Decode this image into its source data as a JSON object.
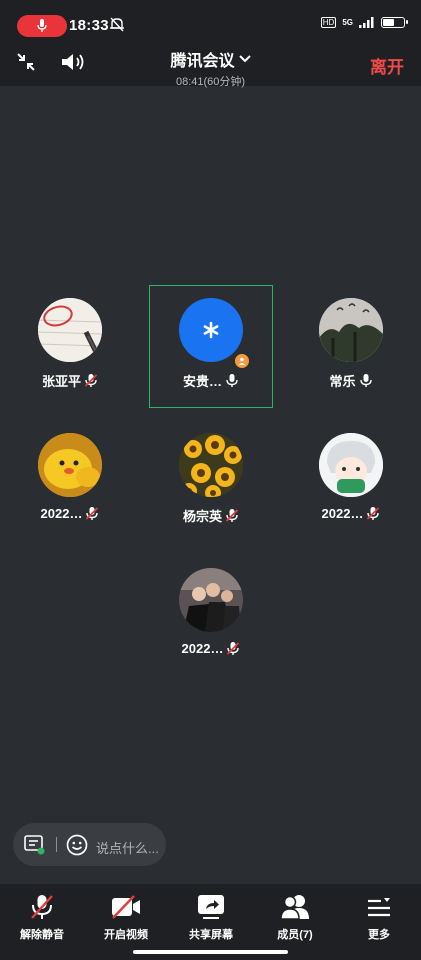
{
  "status_bar": {
    "time": "18:33",
    "hd": "HD",
    "network": "5G",
    "battery_level": 0.6
  },
  "header": {
    "title": "腾讯会议",
    "subtitle": "08:41(60分钟)",
    "leave_label": "离开"
  },
  "participants": [
    {
      "name": "张亚平",
      "mic": "muted"
    },
    {
      "name": "安贵…",
      "mic": "on",
      "speaking": true,
      "host": true
    },
    {
      "name": "常乐",
      "mic": "on"
    },
    {
      "name": "2022…",
      "mic": "muted"
    },
    {
      "name": "杨宗英",
      "mic": "muted"
    },
    {
      "name": "2022…",
      "mic": "muted"
    },
    {
      "name": "2022…",
      "mic": "muted"
    }
  ],
  "chat": {
    "placeholder": "说点什么..."
  },
  "toolbar": {
    "unmute_label": "解除静音",
    "video_label": "开启视频",
    "share_label": "共享屏幕",
    "members_label": "成员(7)",
    "more_label": "更多"
  },
  "colors": {
    "background": "#2a2d31",
    "bar": "#1e2023",
    "leave": "#f24a4a",
    "recording": "#e9353a",
    "active_border": "#2fb463",
    "muted_slash": "#e23c3c",
    "avatar_blue": "#1a73f0"
  }
}
